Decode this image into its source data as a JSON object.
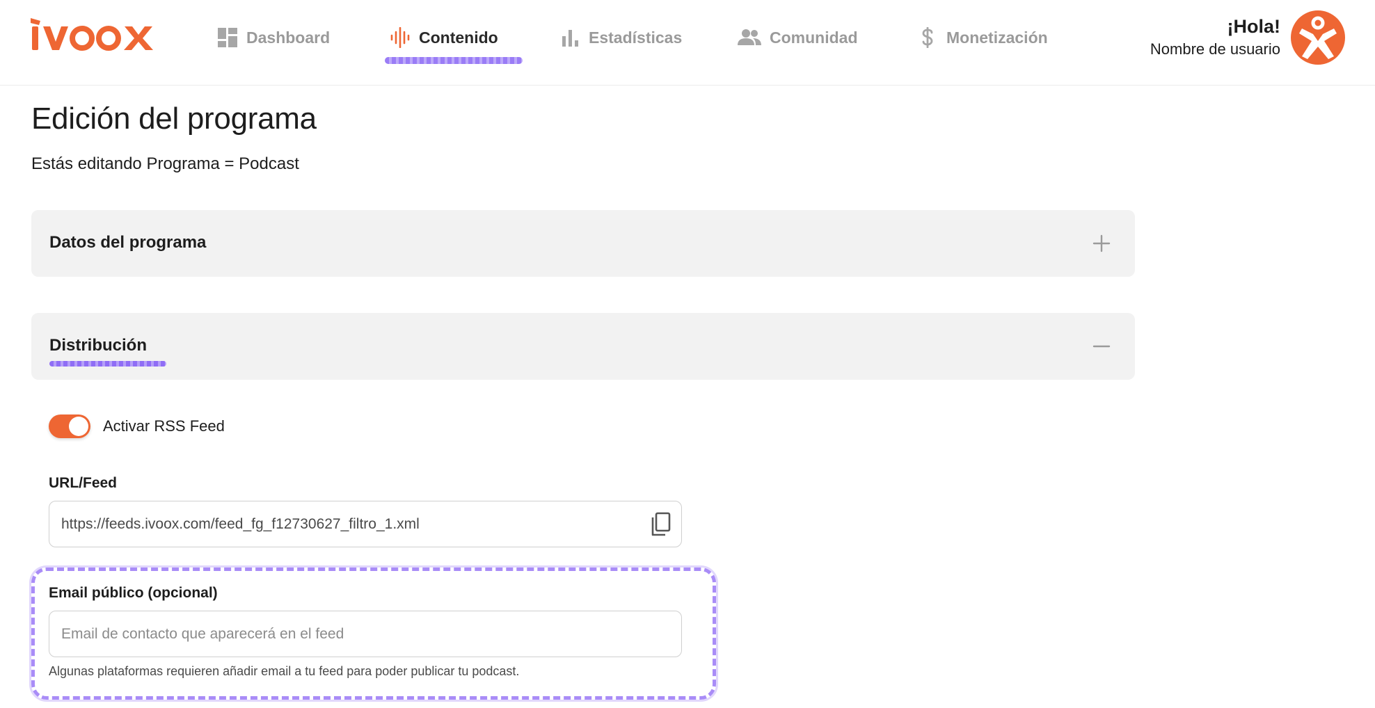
{
  "header": {
    "logo_text": "ivoox",
    "nav": [
      {
        "id": "dashboard",
        "label": "Dashboard",
        "icon": "dashboard-icon",
        "active": false
      },
      {
        "id": "contenido",
        "label": "Contenido",
        "icon": "audio-wave-icon",
        "active": true
      },
      {
        "id": "estadisticas",
        "label": "Estadísticas",
        "icon": "bar-chart-icon",
        "active": false
      },
      {
        "id": "comunidad",
        "label": "Comunidad",
        "icon": "people-icon",
        "active": false
      },
      {
        "id": "monetizacion",
        "label": "Monetización",
        "icon": "dollar-icon",
        "active": false
      }
    ],
    "greeting": "¡Hola!",
    "username": "Nombre de usuario",
    "avatar_icon": "ivoox-person-icon"
  },
  "page": {
    "title": "Edición del programa",
    "subtitle": "Estás editando Programa = Podcast"
  },
  "sections": {
    "datos": {
      "title": "Datos del programa",
      "state": "collapsed",
      "icon": "plus-icon"
    },
    "distribucion": {
      "title": "Distribución",
      "state": "expanded",
      "icon": "minus-icon"
    }
  },
  "distribution": {
    "rss_toggle_label": "Activar RSS Feed",
    "rss_enabled": true,
    "url_label": "URL/Feed",
    "url_value": "https://feeds.ivoox.com/feed_fg_f12730627_filtro_1.xml",
    "email_label": "Email público (opcional)",
    "email_value": "",
    "email_placeholder": "Email de contacto que aparecerá en el feed",
    "email_helper": "Algunas plataformas requieren añadir email a tu feed para poder publicar tu podcast."
  },
  "colors": {
    "brand": "#ee6633",
    "highlight": "#a98cf7",
    "panel": "#f2f2f2",
    "text": "#1d1d1d",
    "muted": "#9a9a9a"
  }
}
